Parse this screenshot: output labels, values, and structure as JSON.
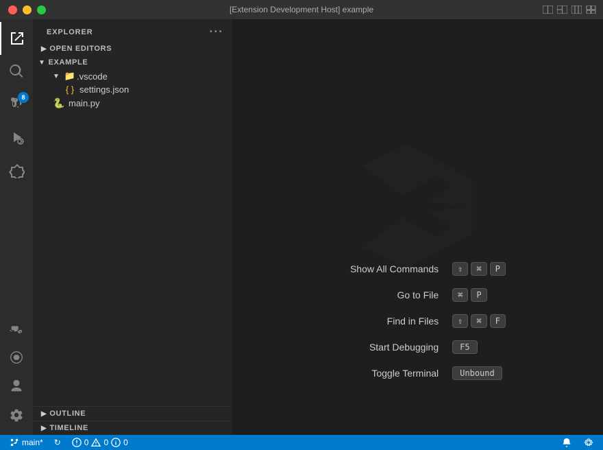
{
  "titleBar": {
    "title": "[Extension Development Host] example",
    "controls": {
      "close": "close",
      "minimize": "minimize",
      "maximize": "maximize"
    }
  },
  "activityBar": {
    "items": [
      {
        "id": "explorer",
        "label": "Explorer",
        "active": true
      },
      {
        "id": "search",
        "label": "Search",
        "active": false
      },
      {
        "id": "source-control",
        "label": "Source Control",
        "active": false,
        "badge": "8"
      },
      {
        "id": "run",
        "label": "Run and Debug",
        "active": false
      },
      {
        "id": "extensions",
        "label": "Extensions",
        "active": false
      }
    ],
    "bottomItems": [
      {
        "id": "remote",
        "label": "Remote Explorer"
      },
      {
        "id": "gpu",
        "label": "GPU"
      },
      {
        "id": "account",
        "label": "Account"
      },
      {
        "id": "settings",
        "label": "Settings"
      }
    ]
  },
  "sidebar": {
    "title": "EXPLORER",
    "sections": {
      "openEditors": {
        "label": "OPEN EDITORS",
        "collapsed": false
      },
      "example": {
        "label": "EXAMPLE",
        "collapsed": false,
        "children": [
          {
            "label": ".vscode",
            "type": "folder",
            "children": [
              {
                "label": "settings.json",
                "type": "json"
              }
            ]
          },
          {
            "label": "main.py",
            "type": "python"
          }
        ]
      }
    },
    "outline": {
      "label": "OUTLINE"
    },
    "timeline": {
      "label": "TIMELINE"
    }
  },
  "editor": {
    "watermark": "vscode-logo",
    "shortcuts": [
      {
        "label": "Show All Commands",
        "keys": [
          "⇧",
          "⌘",
          "P"
        ]
      },
      {
        "label": "Go to File",
        "keys": [
          "⌘",
          "P"
        ]
      },
      {
        "label": "Find in Files",
        "keys": [
          "⇧",
          "⌘",
          "F"
        ]
      },
      {
        "label": "Start Debugging",
        "keys": [
          "F5"
        ]
      },
      {
        "label": "Toggle Terminal",
        "keys": [
          "Unbound"
        ]
      }
    ]
  },
  "statusBar": {
    "branch": "main*",
    "sync": "↻",
    "errors": "0",
    "warnings": "0",
    "infoCount": "0",
    "rightItems": [
      {
        "label": "🔔",
        "id": "notifications"
      },
      {
        "label": "⚙",
        "id": "manage"
      }
    ]
  }
}
